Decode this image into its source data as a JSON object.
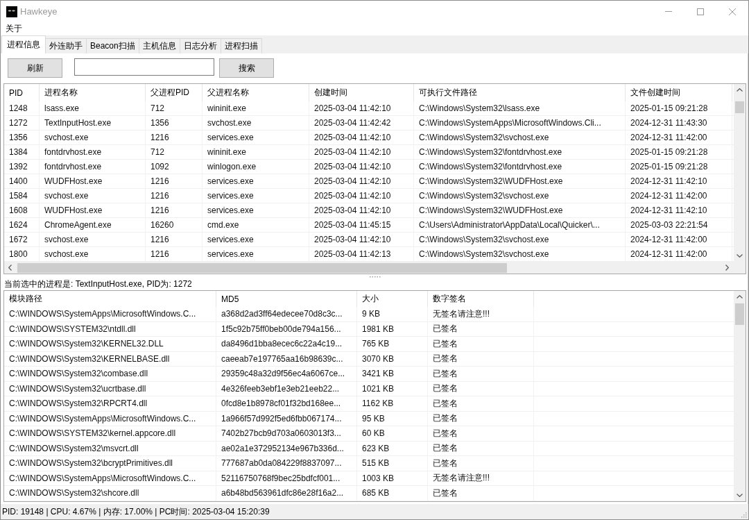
{
  "window": {
    "title": "Hawkeye"
  },
  "menu": [
    {
      "label": "关于"
    }
  ],
  "tabs": [
    {
      "label": "进程信息",
      "selected": true
    },
    {
      "label": "外连助手",
      "selected": false
    },
    {
      "label": "Beacon扫描",
      "selected": false
    },
    {
      "label": "主机信息",
      "selected": false
    },
    {
      "label": "日志分析",
      "selected": false
    },
    {
      "label": "进程扫描",
      "selected": false
    }
  ],
  "toolbar": [
    {
      "kind": "button",
      "label": "刷新"
    },
    {
      "kind": "input"
    },
    {
      "kind": "button",
      "label": "搜索"
    }
  ],
  "process_table": {
    "columns": [
      "PID",
      "进程名称",
      "父进程PID",
      "父进程名称",
      "创建时间",
      "可执行文件路径",
      "文件创建时间"
    ],
    "rows": [
      [
        "1248",
        "lsass.exe",
        "712",
        "wininit.exe",
        "2025-03-04 11:42:10",
        "C:\\Windows\\System32\\lsass.exe",
        "2025-01-15 09:21:28"
      ],
      [
        "1272",
        "TextInputHost.exe",
        "1356",
        "svchost.exe",
        "2025-03-04 11:42:42",
        "C:\\Windows\\SystemApps\\MicrosoftWindows.Cli...",
        "2024-12-31 11:43:30"
      ],
      [
        "1356",
        "svchost.exe",
        "1216",
        "services.exe",
        "2025-03-04 11:42:10",
        "C:\\Windows\\System32\\svchost.exe",
        "2024-12-31 11:42:00"
      ],
      [
        "1384",
        "fontdrvhost.exe",
        "712",
        "wininit.exe",
        "2025-03-04 11:42:10",
        "C:\\Windows\\System32\\fontdrvhost.exe",
        "2025-01-15 09:21:28"
      ],
      [
        "1392",
        "fontdrvhost.exe",
        "1092",
        "winlogon.exe",
        "2025-03-04 11:42:10",
        "C:\\Windows\\System32\\fontdrvhost.exe",
        "2025-01-15 09:21:28"
      ],
      [
        "1400",
        "WUDFHost.exe",
        "1216",
        "services.exe",
        "2025-03-04 11:42:10",
        "C:\\Windows\\System32\\WUDFHost.exe",
        "2024-12-31 11:42:10"
      ],
      [
        "1584",
        "svchost.exe",
        "1216",
        "services.exe",
        "2025-03-04 11:42:10",
        "C:\\Windows\\System32\\svchost.exe",
        "2024-12-31 11:42:00"
      ],
      [
        "1608",
        "WUDFHost.exe",
        "1216",
        "services.exe",
        "2025-03-04 11:42:10",
        "C:\\Windows\\System32\\WUDFHost.exe",
        "2024-12-31 11:42:10"
      ],
      [
        "1624",
        "ChromeAgent.exe",
        "16260",
        "cmd.exe",
        "2025-03-04 11:45:15",
        "C:\\Users\\Administrator\\AppData\\Local\\Quicker\\...",
        "2025-03-03 22:21:54"
      ],
      [
        "1672",
        "svchost.exe",
        "1216",
        "services.exe",
        "2025-03-04 11:42:10",
        "C:\\Windows\\System32\\svchost.exe",
        "2024-12-31 11:42:00"
      ],
      [
        "1800",
        "svchost.exe",
        "1216",
        "services.exe",
        "2025-03-04 11:42:13",
        "C:\\Windows\\System32\\svchost.exe",
        "2024-12-31 11:42:00"
      ]
    ]
  },
  "selection_label": "当前选中的进程是: TextInputHost.exe, PID为: 1272",
  "module_table": {
    "columns": [
      "模块路径",
      "MD5",
      "大小",
      "数字签名"
    ],
    "rows": [
      [
        "C:\\WINDOWS\\SystemApps\\MicrosoftWindows.C...",
        "a368d2ad3ff64edecee70d8c3c...",
        "9 KB",
        "无签名请注意!!!"
      ],
      [
        "C:\\WINDOWS\\SYSTEM32\\ntdll.dll",
        "1f5c92b75ff0beb00de794a156...",
        "1981 KB",
        "已签名"
      ],
      [
        "C:\\WINDOWS\\System32\\KERNEL32.DLL",
        "da8496d1bba8ecec6c22a4c19...",
        "765 KB",
        "已签名"
      ],
      [
        "C:\\WINDOWS\\System32\\KERNELBASE.dll",
        "caeeab7e197765aa16b98639c...",
        "3070 KB",
        "已签名"
      ],
      [
        "C:\\WINDOWS\\System32\\combase.dll",
        "29359c48a32d9f56ec4a6067ce...",
        "3421 KB",
        "已签名"
      ],
      [
        "C:\\WINDOWS\\System32\\ucrtbase.dll",
        "4e326feeb3ebf1e3eb21eeb22...",
        "1021 KB",
        "已签名"
      ],
      [
        "C:\\WINDOWS\\System32\\RPCRT4.dll",
        "0fcd8e1b8978cf01f32bd168ee...",
        "1162 KB",
        "已签名"
      ],
      [
        "C:\\WINDOWS\\SystemApps\\MicrosoftWindows.C...",
        "1a966f57d992f5ed6fbb067174...",
        "95 KB",
        "已签名"
      ],
      [
        "C:\\WINDOWS\\SYSTEM32\\kernel.appcore.dll",
        "7402b27bcb9d703a0603013f3...",
        "60 KB",
        "已签名"
      ],
      [
        "C:\\WINDOWS\\System32\\msvcrt.dll",
        "ae02a1e372952134e967b336d...",
        "623 KB",
        "已签名"
      ],
      [
        "C:\\WINDOWS\\System32\\bcryptPrimitives.dll",
        "777687ab0da084229f8837097...",
        "515 KB",
        "已签名"
      ],
      [
        "C:\\WINDOWS\\SystemApps\\MicrosoftWindows.C...",
        "52116750768f9bec25bdfcf001...",
        "1003 KB",
        "无签名请注意!!!"
      ],
      [
        "C:\\WINDOWS\\System32\\shcore.dll",
        "a6b48bd563961dfc86e28f16a2...",
        "685 KB",
        "已签名"
      ]
    ]
  },
  "status_bar": "PID: 19148 | CPU: 4.67% | 内存: 17.00% | PC时间: 2025-03-04 15:20:39"
}
